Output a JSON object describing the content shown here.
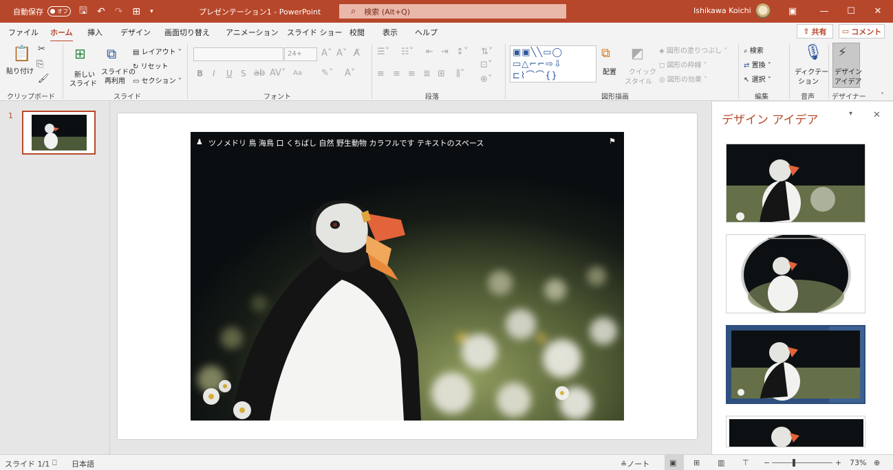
{
  "titlebar": {
    "autosave_label": "自動保存",
    "autosave_state": "オフ",
    "doc_title": "プレゼンテーション1 - PowerPoint",
    "search_placeholder": "検索 (Alt+Q)",
    "user_name": "Ishikawa Koichi"
  },
  "menu": [
    "ファイル",
    "ホーム",
    "挿入",
    "デザイン",
    "画面切り替え",
    "アニメーション",
    "スライド ショー",
    "校閲",
    "表示",
    "ヘルプ"
  ],
  "menu_active": "ホーム",
  "share_label": "共有",
  "comment_label": "コメント",
  "ribbon": {
    "clipboard": {
      "paste": "貼り付け",
      "group": "クリップボード"
    },
    "slides": {
      "new_slide_1": "新しい",
      "new_slide_2": "スライド",
      "reuse_1": "スライドの",
      "reuse_2": "再利用",
      "layout": "レイアウト",
      "reset": "リセット",
      "section": "セクション",
      "group": "スライド"
    },
    "font": {
      "size": "24+",
      "group": "フォント",
      "bold": "B",
      "italic": "I",
      "underline": "U",
      "strike": "S",
      "case": "Aa"
    },
    "paragraph": {
      "group": "段落"
    },
    "drawing": {
      "arrange": "配置",
      "quick_1": "クイック",
      "quick_2": "スタイル",
      "fill": "図形の塗りつぶし",
      "outline": "図形の枠線",
      "effects": "図形の効果",
      "group": "図形描画"
    },
    "editing": {
      "find": "検索",
      "replace": "置換",
      "select": "選択",
      "group": "編集"
    },
    "voice": {
      "dictate_1": "ディクテー",
      "dictate_2": "ション",
      "group": "音声"
    },
    "designer": {
      "ideas_1": "デザイン",
      "ideas_2": "アイデア",
      "group": "デザイナー"
    }
  },
  "slides_pane": {
    "slide_number": "1"
  },
  "slide": {
    "caption": "ツノメドリ 鳥 海鳥 口 くちばし 自然 野生動物 カラフルです テキストのスペース"
  },
  "design_pane": {
    "title": "デザイン アイデア"
  },
  "status": {
    "slide_info": "スライド 1/1",
    "language": "日本語",
    "notes": "ノート",
    "zoom": "73%"
  },
  "colors": {
    "accent": "#b7472a",
    "selected_idea_border": "#2f4f7f"
  }
}
